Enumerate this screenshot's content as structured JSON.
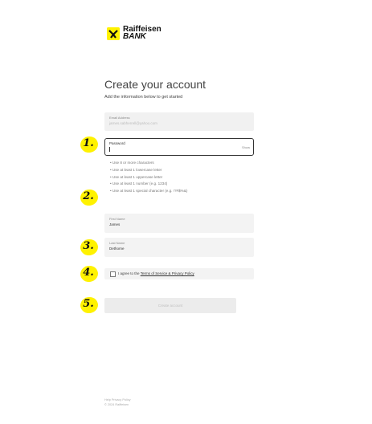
{
  "brand": {
    "line1": "Raiffeisen",
    "line2": "BANK",
    "color": "#fff200"
  },
  "form": {
    "title": "Create your account",
    "subtitle": "Add the information below to get started",
    "email": {
      "label": "Email Address",
      "value": "jarnes.sabherrell@yahoo.com"
    },
    "password": {
      "label": "Password",
      "value": "",
      "toggle": "Show"
    },
    "rules": [
      "Use 8 or more characters",
      "Use at least 1 lowercase letter",
      "Use at least 1 uppercase letter",
      "Use at least 1 number (e.g. 1234)",
      "Use at least 1 special character (e.g. !?#$%&)"
    ],
    "first_name": {
      "label": "First Name",
      "value": "James"
    },
    "last_name": {
      "label": "Last Name",
      "value": "Dethorne"
    },
    "agree": {
      "prefix": "I agree to the ",
      "link": "Terms of Service & Privacy Policy",
      "checked": false
    },
    "submit_label": "Create account"
  },
  "steps": [
    "1.",
    "2.",
    "3.",
    "4.",
    "5."
  ],
  "footer": {
    "line1": "Help   Privacy Policy",
    "line2": "© 2024 Raiffeisen"
  }
}
